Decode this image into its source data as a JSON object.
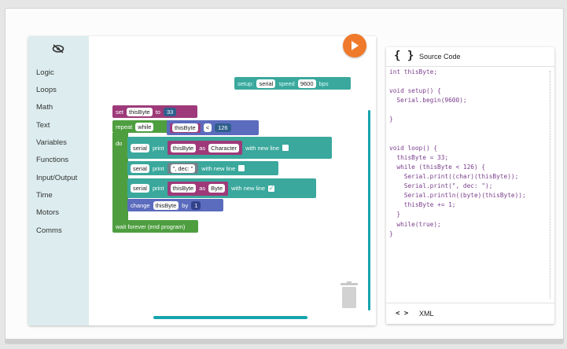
{
  "toolbox": {
    "icon": "eye-off-icon",
    "categories": [
      "Logic",
      "Loops",
      "Math",
      "Text",
      "Variables",
      "Functions",
      "Input/Output",
      "Time",
      "Motors",
      "Comms"
    ]
  },
  "run_button": {
    "icon": "play-icon",
    "color": "#f07a2b"
  },
  "blocks": {
    "setup": {
      "label": "setup:",
      "serial": "serial",
      "speed_label": "speed",
      "speed": "9600",
      "unit": "bps"
    },
    "set_var": {
      "label": "set",
      "var": "thisByte",
      "to": "to",
      "value": "33"
    },
    "repeat": {
      "label": "repeat",
      "mode": "while",
      "var": "thisByte",
      "op": "<",
      "value": "126"
    },
    "do_label": "do",
    "print1": {
      "serial": "serial",
      "label": "print",
      "var": "thisByte",
      "as": "as",
      "type": "Character",
      "newline": "with new line"
    },
    "print2": {
      "serial": "serial",
      "label": "print",
      "text": "\", dec: \"",
      "newline": "with new line"
    },
    "print3": {
      "serial": "serial",
      "label": "print",
      "var": "thisByte",
      "as": "as",
      "type": "Byte",
      "newline": "with new line"
    },
    "change": {
      "label": "change",
      "var": "thisByte",
      "by": "by",
      "value": "1"
    },
    "wait": {
      "label": "wait forever (end program)"
    }
  },
  "source_panel": {
    "icon": "{ }",
    "title": "Source Code",
    "code_lines": [
      "int thisByte;",
      "",
      "void setup() {",
      "  Serial.begin(9600);",
      "",
      "}",
      "",
      "",
      "void loop() {",
      "  thisByte = 33;",
      "  while (thisByte < 126) {",
      "    Serial.print((char)(thisByte));",
      "    Serial.print(\", dec: \");",
      "    Serial.println((byte)(thisByte));",
      "    thisByte += 1;",
      "  }",
      "  while(true);",
      "}"
    ],
    "footer_icon": "< >",
    "footer_label": "XML"
  }
}
